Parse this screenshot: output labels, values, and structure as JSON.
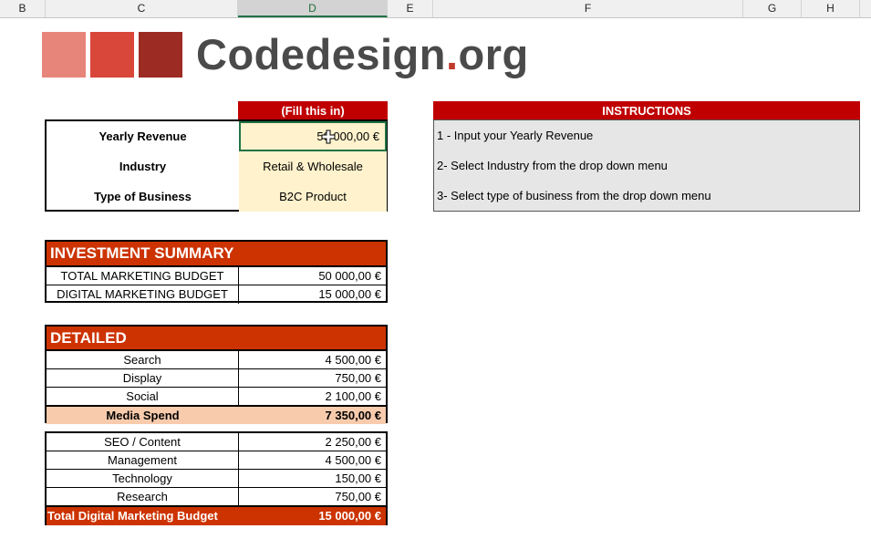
{
  "columns": [
    "B",
    "C",
    "D",
    "E",
    "F",
    "G",
    "H"
  ],
  "active_column": "D",
  "logo": {
    "brand": "Codedesign",
    "dot": ".",
    "tld": "org",
    "square_colors": [
      "#e8857a",
      "#d9463a",
      "#9c2b24"
    ]
  },
  "inputs": {
    "header": "(Fill this in)",
    "rows": [
      {
        "label": "Yearly Revenue",
        "value": "50 000,00 €"
      },
      {
        "label": "Industry",
        "value": "Retail & Wholesale"
      },
      {
        "label": "Type of Business",
        "value": "B2C Product"
      }
    ]
  },
  "instructions": {
    "header": "INSTRUCTIONS",
    "lines": [
      "1 - Input your Yearly Revenue",
      "2- Select Industry from the drop down menu",
      "3- Select type of business from the drop down menu"
    ]
  },
  "investment_summary": {
    "title": "INVESTMENT SUMMARY",
    "rows": [
      {
        "label": "TOTAL MARKETING BUDGET",
        "value": "50 000,00 €"
      },
      {
        "label": "DIGITAL MARKETING BUDGET",
        "value": "15 000,00 €"
      }
    ]
  },
  "detailed": {
    "title": "DETAILED",
    "media_rows": [
      {
        "label": "Search",
        "value": "4 500,00 €"
      },
      {
        "label": "Display",
        "value": "750,00 €"
      },
      {
        "label": "Social",
        "value": "2 100,00 €"
      }
    ],
    "media_total": {
      "label": "Media Spend",
      "value": "7 350,00 €"
    },
    "other_rows": [
      {
        "label": "SEO / Content",
        "value": "2 250,00 €"
      },
      {
        "label": "Management",
        "value": "4 500,00 €"
      },
      {
        "label": "Technology",
        "value": "150,00 €"
      },
      {
        "label": "Research",
        "value": "750,00 €"
      }
    ],
    "grand_total": {
      "label": "Total Digital Marketing Budget",
      "value": "15 000,00 €"
    }
  },
  "colors": {
    "accent_red": "#c00000",
    "section_red": "#cc3300",
    "input_fill": "#fff2cc",
    "media_fill": "#f8cbad",
    "excel_green": "#217346"
  }
}
